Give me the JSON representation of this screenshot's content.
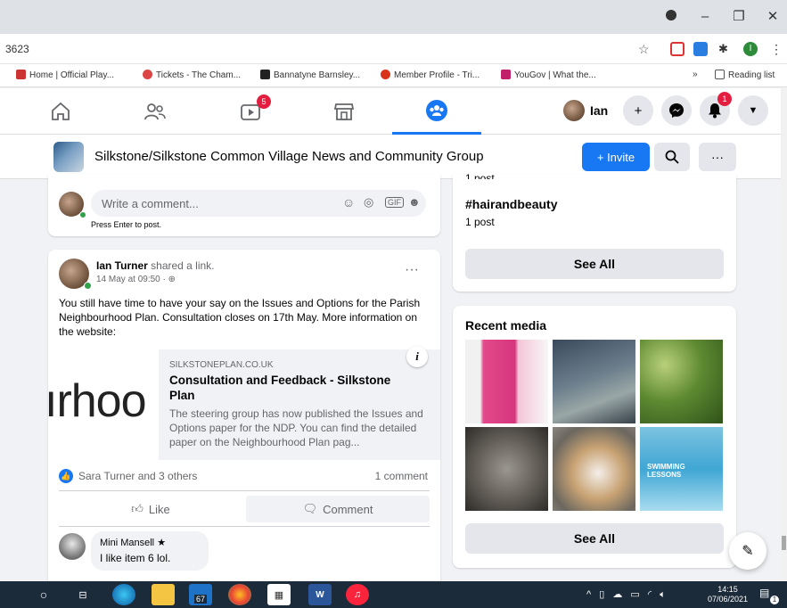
{
  "browser": {
    "url_fragment": "3623",
    "bookmarks": [
      "Home | Official Play...",
      "Tickets - The Cham...",
      "Bannatyne Barnsley...",
      "Member Profile - Tri...",
      "YouGov | What the..."
    ],
    "bookmarks_overflow": "»",
    "reading_list": "Reading list",
    "profile_initial": "I"
  },
  "fbnav": {
    "video_badge": "5",
    "user_name": "Ian",
    "notif_badge": "1"
  },
  "group": {
    "name": "Silkstone/Silkstone Common Village News and Community Group",
    "invite_label": "+ Invite"
  },
  "comment_box": {
    "placeholder": "Write a comment...",
    "hint": "Press Enter to post."
  },
  "post": {
    "author": "Ian Turner",
    "action": "shared a link.",
    "time": "14 May at 09:50 ·",
    "text": "You still have time to have your say on the Issues and Options for the Parish Neighbourhood Plan. Consultation closes on 17th May. More information on the website:",
    "link": {
      "domain": "SILKSTONEPLAN.CO.UK",
      "title": "Consultation and Feedback - Silkstone Plan",
      "desc": "The steering group has now published the Issues and Options paper for the NDP.  You can find the detailed paper on the Neighbourhood Plan pag...",
      "image_text": "ırhoo",
      "info": "i"
    },
    "reactions": "Sara Turner and 3 others",
    "comments_count": "1 comment",
    "like_label": "Like",
    "comment_label": "Comment"
  },
  "reply": {
    "author": "Mini Mansell",
    "text": "I like item 6 lol."
  },
  "sidebar": {
    "top_fragment": "1 post",
    "hashtag": "#hairandbeauty",
    "hashtag_posts": "1 post",
    "see_all": "See All",
    "recent_media_title": "Recent media",
    "media_caption": "SWIMMING LESSONS",
    "see_all_2": "See All"
  },
  "taskbar": {
    "mail_count": "67",
    "time": "14:15",
    "date": "07/06/2021",
    "notif_count": "1"
  },
  "colors": {
    "fb_blue": "#1877f2",
    "badge_red": "#e41e3f"
  }
}
